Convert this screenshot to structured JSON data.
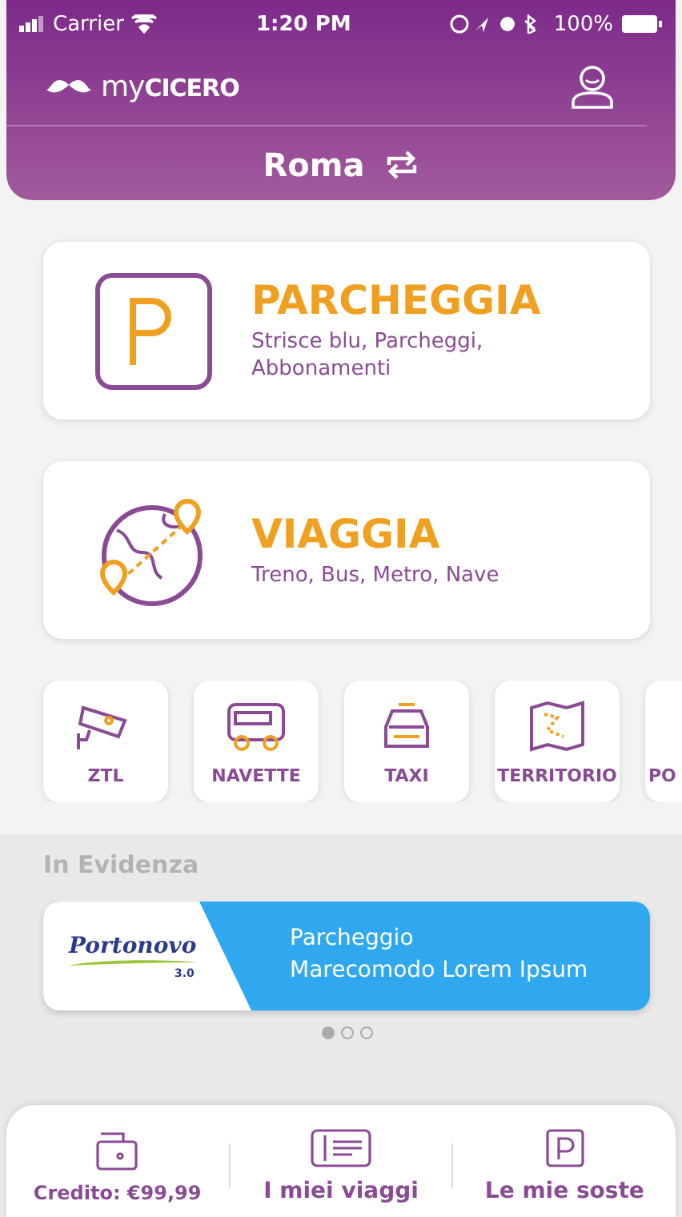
{
  "status_bar": {
    "carrier": "Carrier",
    "time": "1:20 PM",
    "battery": "100%"
  },
  "header": {
    "logo": "my**CICERO**",
    "city": "Roma"
  },
  "main_cards": [
    {
      "kind": "parking",
      "title": "PARCHEGGIA",
      "subtitle": "Strisce blu, Parcheggi, Abbonamenti"
    },
    {
      "kind": "travel",
      "title": "VIAGGIA",
      "subtitle": "Treno, Bus, Metro, Nave"
    }
  ],
  "shortcuts": [
    {
      "kind": "camera",
      "label": "ZTL"
    },
    {
      "kind": "bus",
      "label": "NAVETTE"
    },
    {
      "kind": "taxi",
      "label": "TAXI"
    },
    {
      "kind": "map",
      "label": "TERRITORIO"
    },
    {
      "kind": "partial",
      "label": "PO"
    }
  ],
  "featured": {
    "title": "In Evidenza",
    "banner": {
      "brand": "Portonovo",
      "brand_version": "3.0",
      "lines": [
        "Parcheggio",
        "Marecomodo Lorem Ipsum"
      ]
    },
    "pager": [
      {
        "selected": true
      },
      {
        "selected": false
      },
      {
        "selected": false
      }
    ]
  },
  "bottom_bar": [
    {
      "kind": "wallet",
      "label": "Credito: €99,99"
    },
    {
      "kind": "ticket",
      "label": "I miei viaggi"
    },
    {
      "kind": "parking",
      "label": "Le mie soste"
    }
  ]
}
